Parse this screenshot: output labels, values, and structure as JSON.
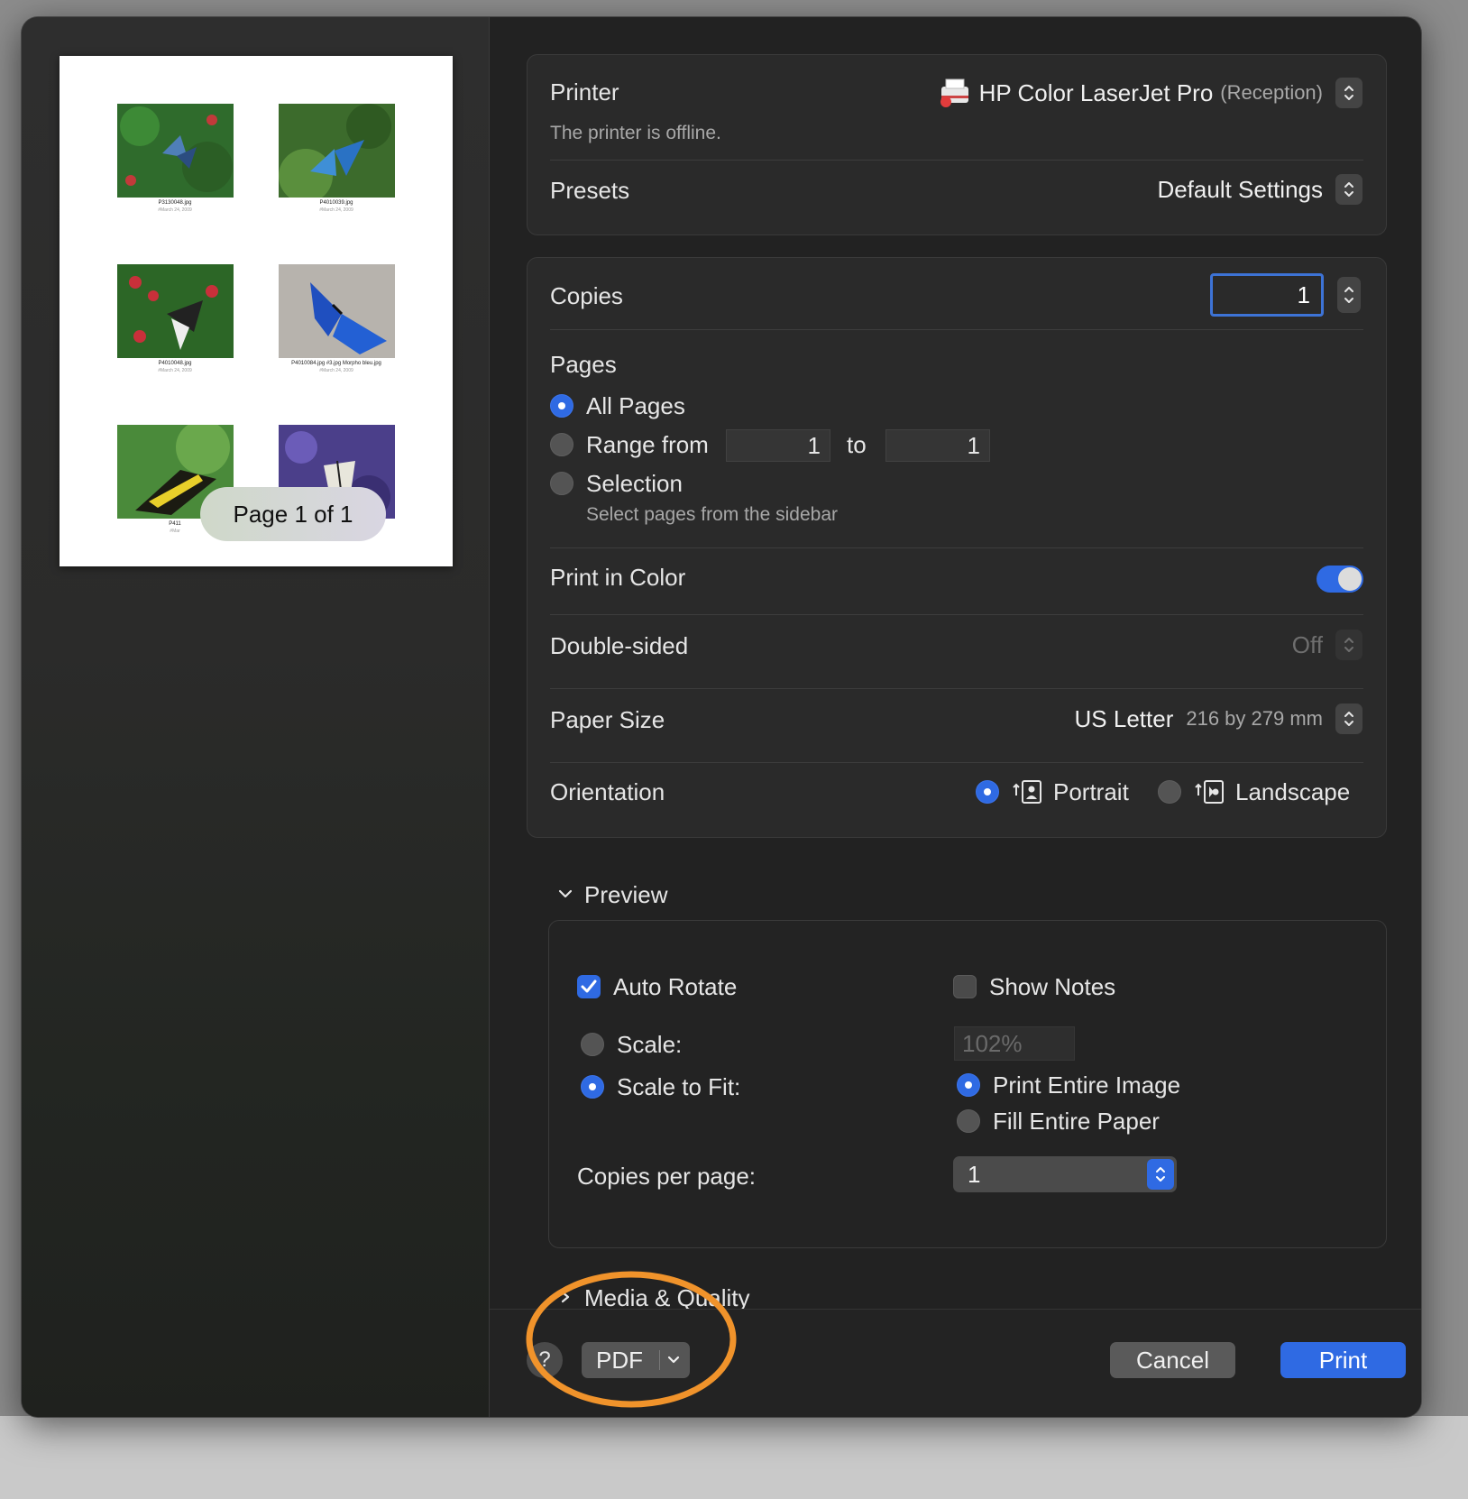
{
  "sidebar": {
    "thumbnails": [
      {
        "caption": "P3130048.jpg",
        "sub": "#March 24, 2009"
      },
      {
        "caption": "P4010039.jpg",
        "sub": "#March 24, 2009"
      },
      {
        "caption": "P4010048.jpg",
        "sub": "#March 24, 2009"
      },
      {
        "caption": "P4010084.jpg #3.jpg Morpho bleu.jpg",
        "sub": "#March 24, 2009"
      },
      {
        "caption": "P411",
        "sub": "#Mar"
      },
      {
        "caption": "jpg",
        "sub": "2009"
      }
    ],
    "page_indicator": "Page 1 of 1"
  },
  "printer": {
    "label": "Printer",
    "name": "HP Color LaserJet Pro",
    "location": "(Reception)",
    "status": "The printer is offline."
  },
  "presets": {
    "label": "Presets",
    "value": "Default Settings"
  },
  "copies": {
    "label": "Copies",
    "value": "1"
  },
  "pages": {
    "label": "Pages",
    "all_pages": "All Pages",
    "range_from": "Range from",
    "range_start": "1",
    "range_to": "to",
    "range_end": "1",
    "selection": "Selection",
    "selection_hint": "Select pages from the sidebar"
  },
  "print_in_color": {
    "label": "Print in Color",
    "enabled": true
  },
  "double_sided": {
    "label": "Double-sided",
    "value": "Off"
  },
  "paper_size": {
    "label": "Paper Size",
    "value": "US Letter",
    "dimensions": "216 by 279 mm"
  },
  "orientation": {
    "label": "Orientation",
    "portrait": "Portrait",
    "landscape": "Landscape",
    "selected": "Portrait"
  },
  "preview_section": {
    "title": "Preview",
    "auto_rotate": "Auto Rotate",
    "show_notes": "Show Notes",
    "scale": "Scale:",
    "scale_value": "102%",
    "scale_to_fit": "Scale to Fit:",
    "print_entire_image": "Print Entire Image",
    "fill_entire_paper": "Fill Entire Paper",
    "copies_per_page": "Copies per page:",
    "copies_per_page_value": "1"
  },
  "media_section": {
    "title": "Media & Quality"
  },
  "footer": {
    "help": "?",
    "pdf": "PDF",
    "cancel": "Cancel",
    "print": "Print"
  },
  "colors": {
    "accent": "#2f6ae3",
    "highlight_circle": "#f0932b"
  }
}
